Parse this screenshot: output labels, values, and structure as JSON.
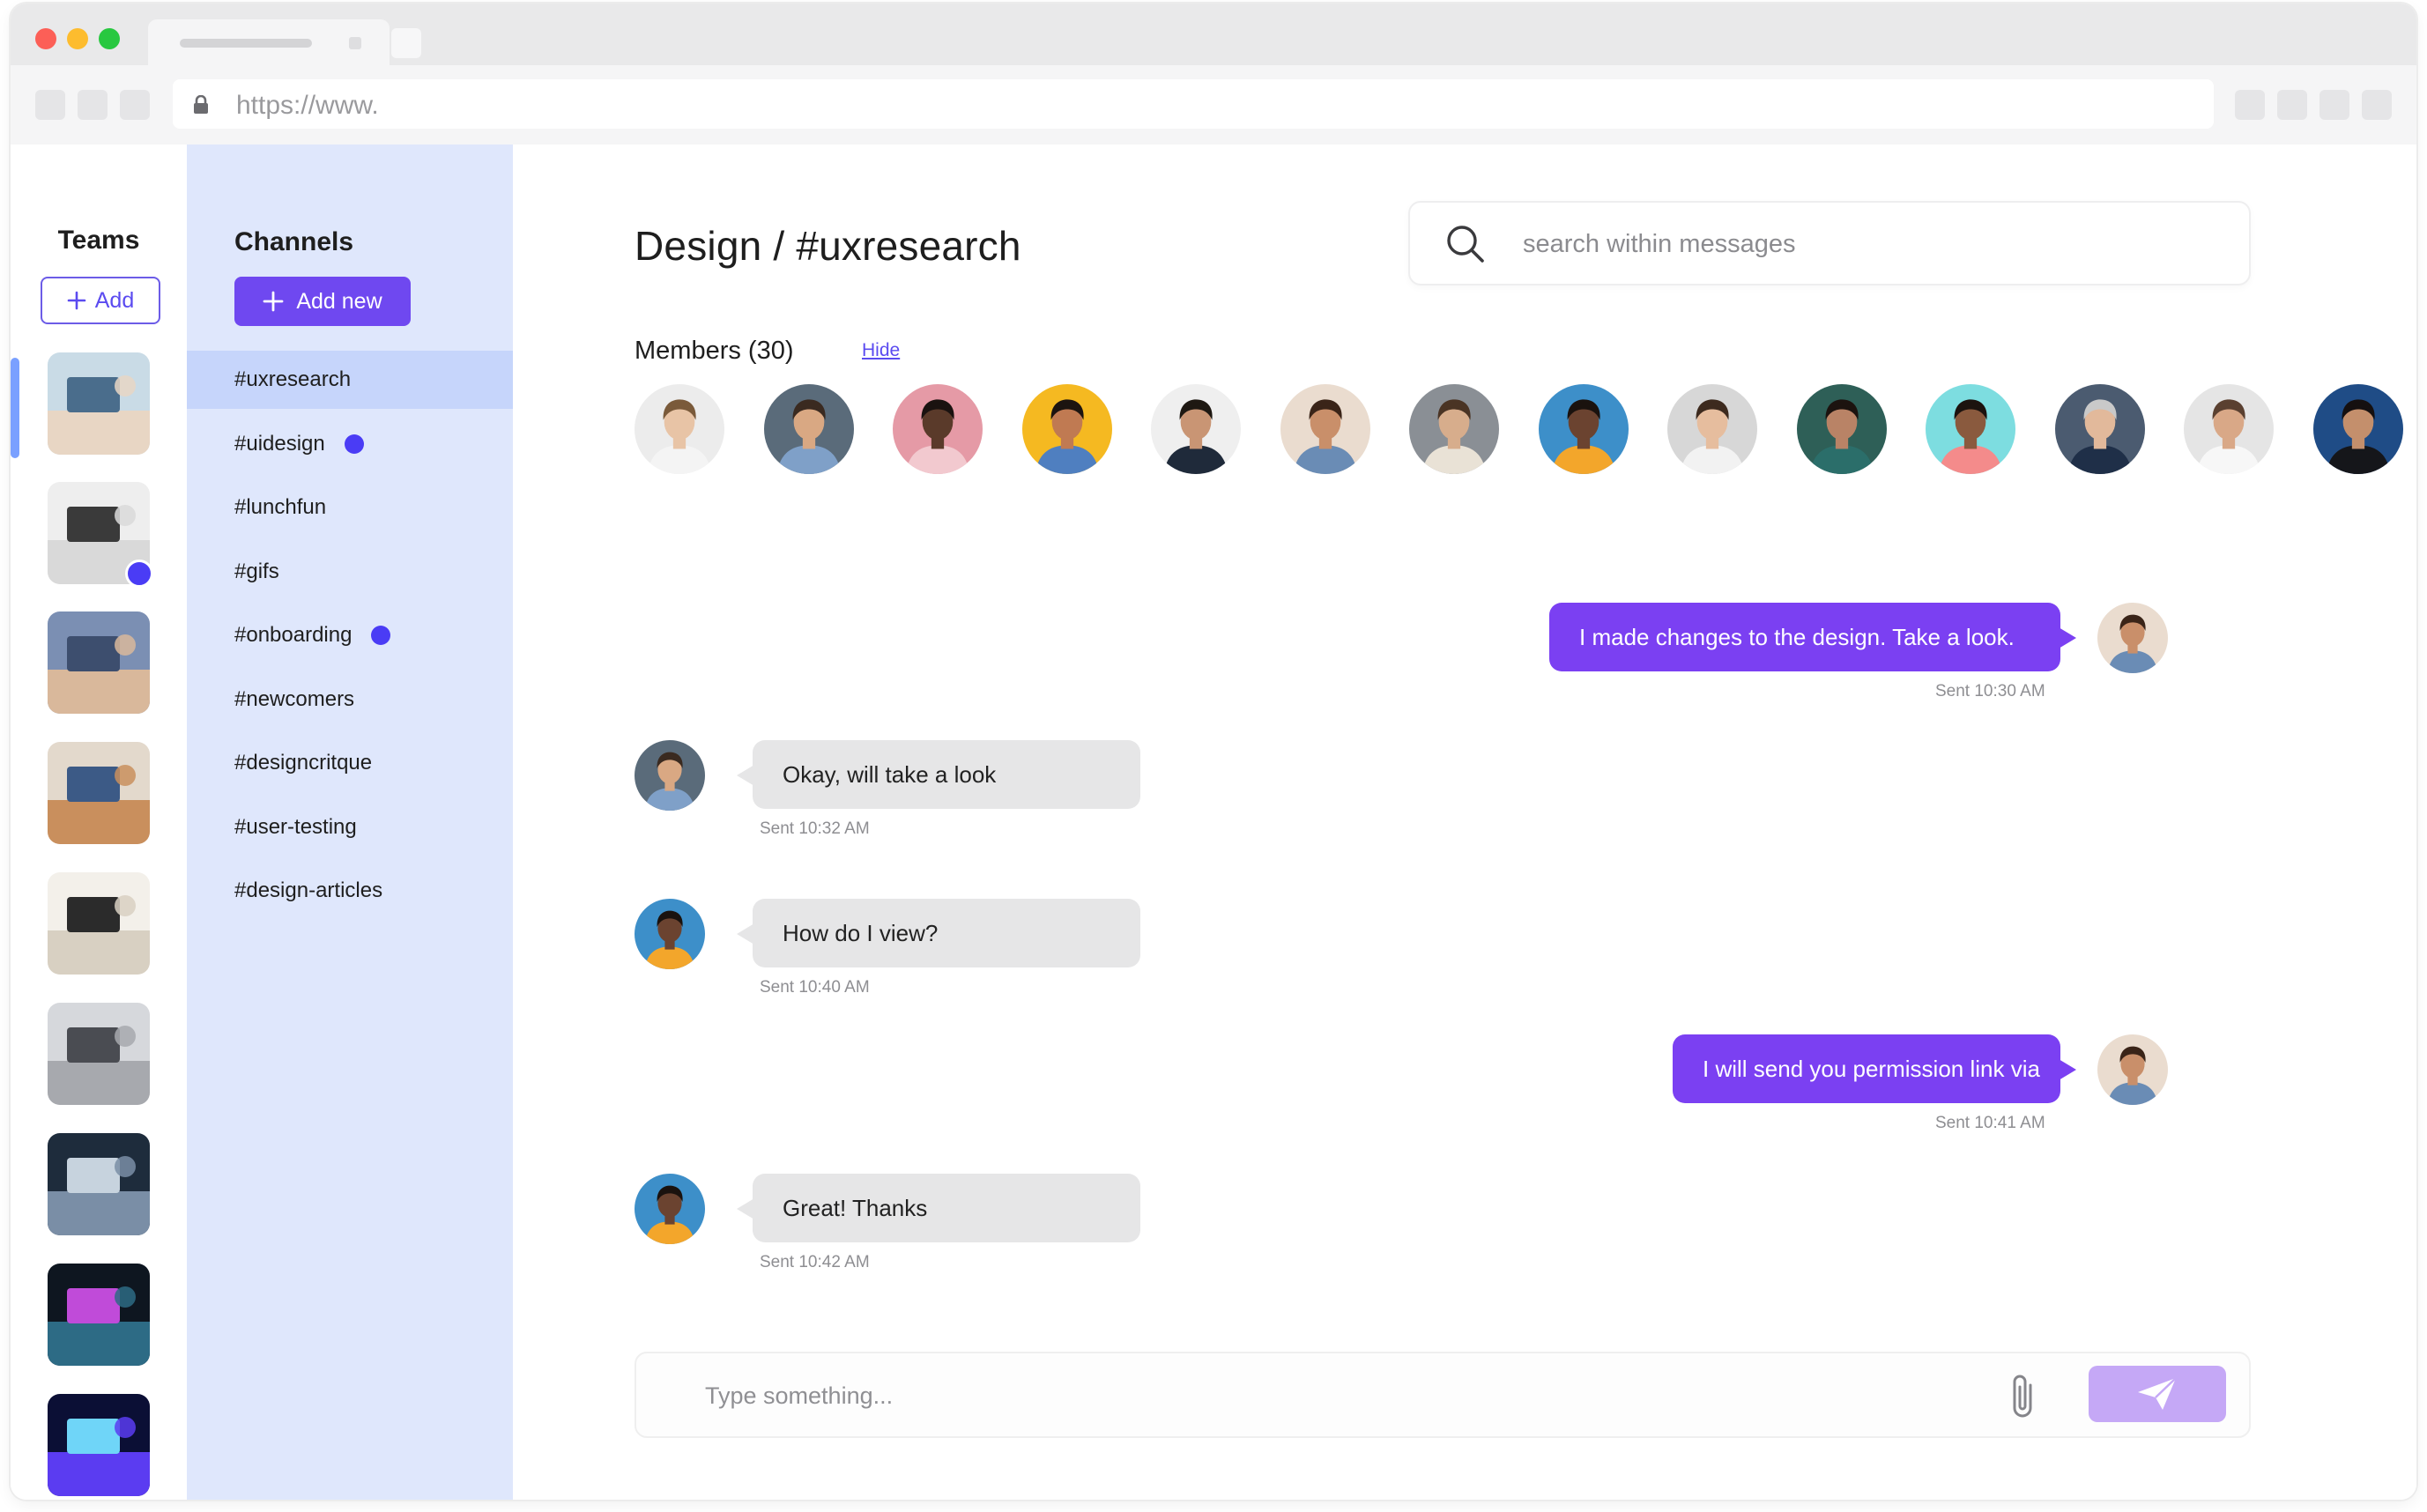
{
  "browser": {
    "url": "https://www."
  },
  "teams": {
    "title": "Teams",
    "add_label": "Add",
    "tiles": [
      {
        "name": "team-tile-1",
        "colors": [
          "#c9dbe6",
          "#e8d6c4",
          "#4a6d8c"
        ],
        "badge": false
      },
      {
        "name": "team-tile-2",
        "colors": [
          "#eeeeee",
          "#d9d9d9",
          "#3a3a3a"
        ],
        "badge": true
      },
      {
        "name": "team-tile-3",
        "colors": [
          "#7b8fb3",
          "#d9b89b",
          "#3d4e6e"
        ],
        "badge": false
      },
      {
        "name": "team-tile-4",
        "colors": [
          "#e3d9cc",
          "#c98f5d",
          "#3c5a86"
        ],
        "badge": false
      },
      {
        "name": "team-tile-5",
        "colors": [
          "#f3f0ea",
          "#d8d0c2",
          "#2b2b2b"
        ],
        "badge": false
      },
      {
        "name": "team-tile-6",
        "colors": [
          "#d6d8dc",
          "#a7a9ae",
          "#4a4c52"
        ],
        "badge": false
      },
      {
        "name": "team-tile-7",
        "colors": [
          "#1e2c3c",
          "#7a8ea6",
          "#c7d3de"
        ],
        "badge": false
      },
      {
        "name": "team-tile-8",
        "colors": [
          "#0e1620",
          "#2d6b85",
          "#c04bd9"
        ],
        "badge": false
      },
      {
        "name": "team-tile-9",
        "colors": [
          "#0b0f35",
          "#5b3cf1",
          "#6fd5f8"
        ],
        "badge": false
      }
    ]
  },
  "channels": {
    "title": "Channels",
    "add_label": "Add new",
    "items": [
      {
        "label": "#uxresearch",
        "active": true,
        "unread": false
      },
      {
        "label": "#uidesign",
        "active": false,
        "unread": true
      },
      {
        "label": "#lunchfun",
        "active": false,
        "unread": false
      },
      {
        "label": "#gifs",
        "active": false,
        "unread": false
      },
      {
        "label": "#onboarding",
        "active": false,
        "unread": true
      },
      {
        "label": "#newcomers",
        "active": false,
        "unread": false
      },
      {
        "label": "#designcritque",
        "active": false,
        "unread": false
      },
      {
        "label": "#user-testing",
        "active": false,
        "unread": false
      },
      {
        "label": "#design-articles",
        "active": false,
        "unread": false
      }
    ]
  },
  "main": {
    "title": "Design / #uxresearch",
    "search_placeholder": "search within messages",
    "members_label": "Members (30)",
    "hide_label": "Hide",
    "members": [
      {
        "bg": "#ececec",
        "skin": "#e8c4a6",
        "hair": "#7a5a3a",
        "shirt": "#f4f4f4"
      },
      {
        "bg": "#5a6b7a",
        "skin": "#d9a883",
        "hair": "#3a2a20",
        "shirt": "#7fa0c8"
      },
      {
        "bg": "#e59aa6",
        "skin": "#5a3a2a",
        "hair": "#1a1210",
        "shirt": "#f2c9cf"
      },
      {
        "bg": "#f5b921",
        "skin": "#c07a52",
        "hair": "#1c1410",
        "shirt": "#4f7fc0"
      },
      {
        "bg": "#efefef",
        "skin": "#c99574",
        "hair": "#1e1812",
        "shirt": "#1f2a3a"
      },
      {
        "bg": "#eadccf",
        "skin": "#c98f6a",
        "hair": "#3a2418",
        "shirt": "#6a8cb5"
      },
      {
        "bg": "#8a8f95",
        "skin": "#d7ad8c",
        "hair": "#4a3424",
        "shirt": "#e9e2d6"
      },
      {
        "bg": "#3d8fc9",
        "skin": "#6b4330",
        "hair": "#1a120e",
        "shirt": "#f3a62b"
      },
      {
        "bg": "#d7d7d7",
        "skin": "#e6bd9e",
        "hair": "#3d2a1e",
        "shirt": "#f2f2f2"
      },
      {
        "bg": "#2e5f57",
        "skin": "#b98366",
        "hair": "#1c130f",
        "shirt": "#2b6e6a"
      },
      {
        "bg": "#7ddde0",
        "skin": "#8a5a3e",
        "hair": "#1c130f",
        "shirt": "#f48b8b"
      },
      {
        "bg": "#4b5b70",
        "skin": "#e2b99b",
        "hair": "#c9c9c9",
        "shirt": "#1f2f48"
      },
      {
        "bg": "#e5e5e5",
        "skin": "#d9a887",
        "hair": "#5a4030",
        "shirt": "#f7f7f7"
      },
      {
        "bg": "#1f4c86",
        "skin": "#c48f6c",
        "hair": "#151010",
        "shirt": "#15161a"
      }
    ],
    "messages": [
      {
        "direction": "out",
        "text": "I made changes to the design. Take a look.",
        "time": "Sent 10:30 AM",
        "avatar": 5
      },
      {
        "direction": "in",
        "text": "Okay, will take a look",
        "time": "Sent 10:32 AM",
        "avatar": 1
      },
      {
        "direction": "in",
        "text": "How do I view?",
        "time": "Sent 10:40 AM",
        "avatar": 7
      },
      {
        "direction": "out",
        "text": "I will send you permission link via",
        "time": "Sent 10:41 AM",
        "avatar": 5
      },
      {
        "direction": "in",
        "text": "Great! Thanks",
        "time": "Sent 10:42 AM",
        "avatar": 7
      }
    ],
    "composer_placeholder": "Type something..."
  },
  "colors": {
    "accent": "#6f48f0",
    "outgoing_bubble": "#7b40f2",
    "incoming_bubble": "#e6e6e7",
    "channels_bg": "#dfe7fc",
    "active_channel": "#c6d5fb",
    "unread_dot": "#4a3cf5",
    "send_button": "#c5a8f6"
  }
}
